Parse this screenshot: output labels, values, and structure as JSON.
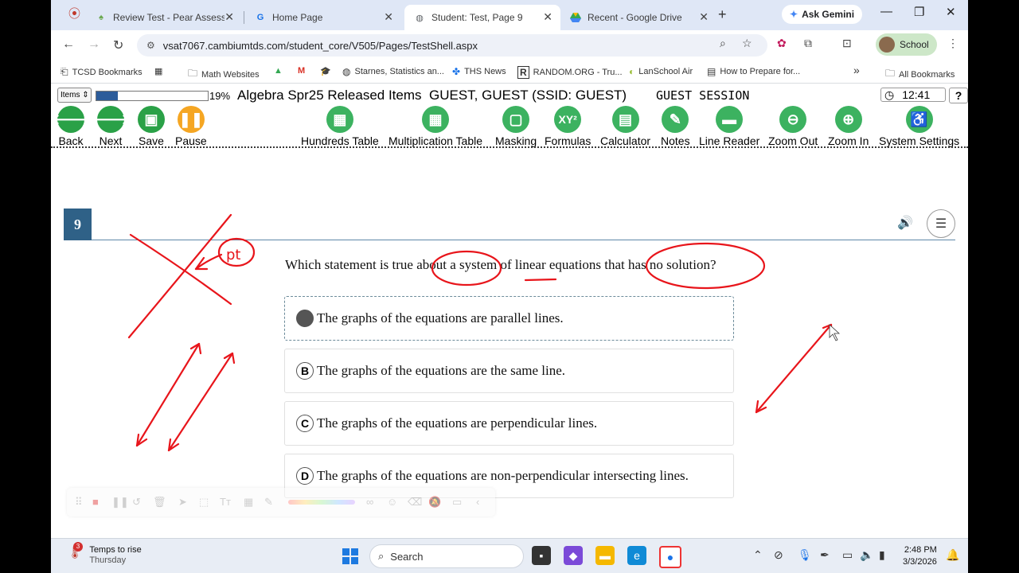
{
  "browser": {
    "tabs": [
      {
        "label": "Review Test - Pear Assessme",
        "icon": "pear-icon"
      },
      {
        "label": "Home Page",
        "icon": "cambium-icon"
      },
      {
        "label": "Student: Test, Page 9",
        "icon": "globe-icon",
        "active": true
      },
      {
        "label": "Recent - Google Drive",
        "icon": "drive-icon"
      }
    ],
    "ask_gemini": "Ask Gemini",
    "url": "vsat7067.cambiumtds.com/student_core/V505/Pages/TestShell.aspx",
    "profile_label": "School",
    "bookmarks": [
      "TCSD Bookmarks",
      "Math Websites",
      "Starnes, Statistics an...",
      "THS News",
      "RANDOM.ORG - Tru...",
      "LanSchool Air",
      "How to Prepare for..."
    ],
    "all_bookmarks": "All Bookmarks"
  },
  "test": {
    "items_label": "Items",
    "progress_fraction": 0.19,
    "progress_pct": "19%",
    "title": "Algebra Spr25 Released Items",
    "student": "GUEST, GUEST (SSID: GUEST)",
    "session": "GUEST SESSION",
    "time": "12:41",
    "help": "?"
  },
  "toolbar": {
    "back": "Back",
    "next": "Next",
    "save": "Save",
    "pause": "Pause",
    "hundreds_table": "Hundreds Table",
    "multiplication_table": "Multiplication Table",
    "masking": "Masking",
    "formulas": "Formulas",
    "calculator": "Calculator",
    "notes": "Notes",
    "line_reader": "Line Reader",
    "zoom_out": "Zoom Out",
    "zoom_in": "Zoom In",
    "system_settings": "System Settings"
  },
  "question": {
    "number": "9",
    "stem": "Which statement is true about a system of linear equations that has no solution?",
    "options": [
      {
        "letter": "A",
        "text": "The graphs of the equations are parallel lines.",
        "selected": true
      },
      {
        "letter": "B",
        "text": "The graphs of the equations are the same line."
      },
      {
        "letter": "C",
        "text": "The graphs of the equations are perpendicular lines."
      },
      {
        "letter": "D",
        "text": "The graphs of the equations are non-perpendicular intersecting lines."
      }
    ]
  },
  "ink": {
    "note": "pt",
    "color": "#e8151b"
  },
  "taskbar": {
    "weather_title": "Temps to rise",
    "weather_sub": "Thursday",
    "notification_count": "3",
    "search": "Search",
    "time": "2:48 PM",
    "date": "3/3/2026"
  }
}
